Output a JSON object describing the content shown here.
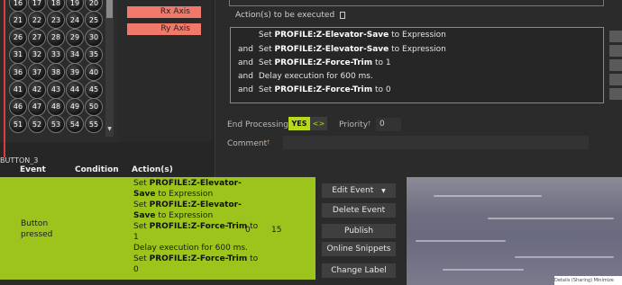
{
  "button_grid": {
    "rows": [
      [
        "16",
        "17",
        "18",
        "19",
        "20"
      ],
      [
        "21",
        "22",
        "23",
        "24",
        "25"
      ],
      [
        "26",
        "27",
        "28",
        "29",
        "30"
      ],
      [
        "31",
        "32",
        "33",
        "34",
        "35"
      ],
      [
        "36",
        "37",
        "38",
        "39",
        "40"
      ],
      [
        "41",
        "42",
        "43",
        "44",
        "45"
      ],
      [
        "46",
        "47",
        "48",
        "49",
        "50"
      ],
      [
        "51",
        "52",
        "53",
        "54",
        "55"
      ]
    ],
    "scroll_arrow": "▼"
  },
  "axes": [
    {
      "label": "Rx Axis"
    },
    {
      "label": "Ry Axis"
    }
  ],
  "editor": {
    "actions_label": "Action(s) to be executed",
    "actions": [
      {
        "prefix": "",
        "verb": "Set",
        "target": "PROFILE:Z-Elevator-Save",
        "rest": "to Expression"
      },
      {
        "prefix": "and",
        "verb": "Set",
        "target": "PROFILE:Z-Elevator-Save",
        "rest": "to Expression"
      },
      {
        "prefix": "and",
        "verb": "Set",
        "target": "PROFILE:Z-Force-Trim",
        "rest": "to 1"
      },
      {
        "prefix": "and",
        "verb": "Delay execution for 600 ms.",
        "target": "",
        "rest": ""
      },
      {
        "prefix": "and",
        "verb": "Set",
        "target": "PROFILE:Z-Force-Trim",
        "rest": "to 0"
      }
    ],
    "end_processing_label": "End Processing",
    "yes_label": "YES",
    "toggle_label": "<>",
    "priority_label": "Priority",
    "priority_value": "0",
    "comment_label": "Comment",
    "comment_value": "",
    "dagger": "†"
  },
  "event_table": {
    "section_label": "BUTTON_3",
    "headers": {
      "event": "Event",
      "condition": "Condition",
      "actions": "Action(s)"
    },
    "row": {
      "event_line1": "Button",
      "event_line2": "pressed",
      "action_lines": [
        {
          "pre": "Set ",
          "bold": "PROFILE:Z-Elevator-",
          "post": ""
        },
        {
          "pre": "",
          "bold": "Save",
          "post": " to Expression"
        },
        {
          "pre": "Set ",
          "bold": "PROFILE:Z-Elevator-",
          "post": ""
        },
        {
          "pre": "",
          "bold": "Save",
          "post": " to Expression"
        },
        {
          "pre": "Set ",
          "bold": "PROFILE:Z-Force-Trim",
          "post": " to"
        },
        {
          "pre": "1",
          "bold": "",
          "post": ""
        },
        {
          "pre": "Delay execution for 600 ms.",
          "bold": "",
          "post": ""
        },
        {
          "pre": "Set ",
          "bold": "PROFILE:Z-Force-Trim",
          "post": " to"
        },
        {
          "pre": "0",
          "bold": "",
          "post": ""
        }
      ],
      "priority": "0",
      "count": "15"
    }
  },
  "action_buttons": {
    "edit_event": "Edit Event",
    "edit_event_arrow": "▼",
    "delete_event": "Delete Event",
    "publish": "Publish",
    "online_snippets": "Online Snippets",
    "change_label": "Change Label"
  },
  "image_caption": "Details (Sharing) Minimize",
  "colors": {
    "accent_green": "#9dc41d",
    "yes_green": "#b7d91b",
    "axis_red": "#f0796a",
    "marker_red": "#e23a3a"
  }
}
